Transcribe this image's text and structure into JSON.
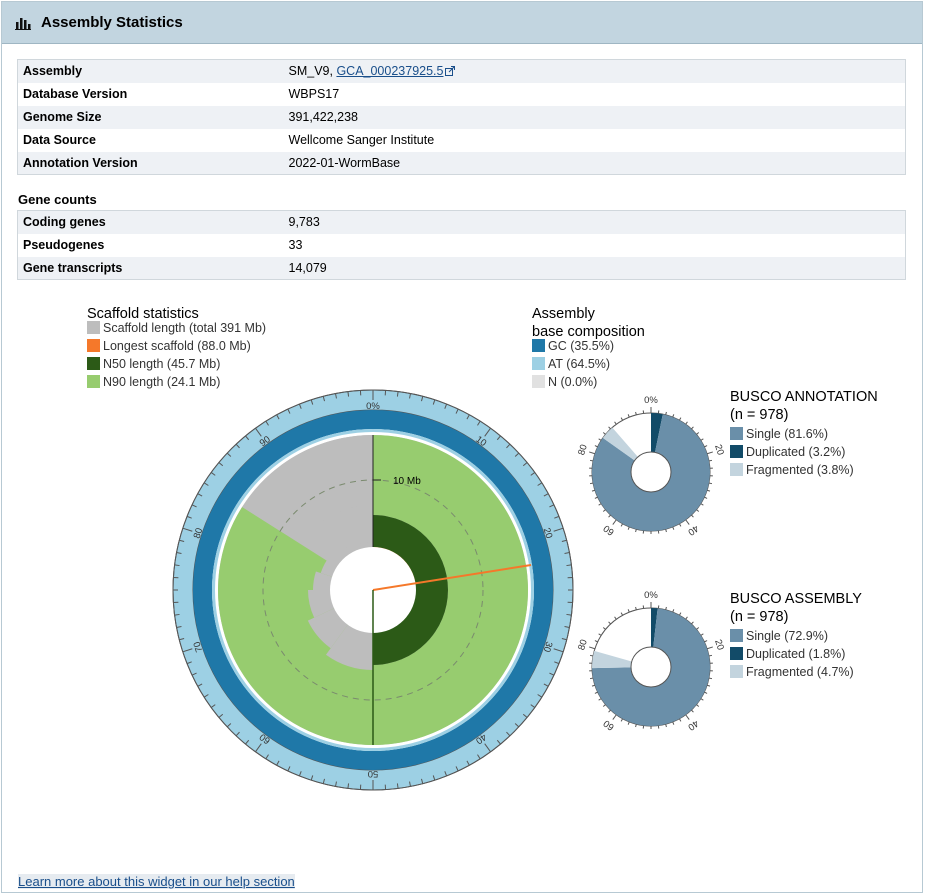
{
  "panel": {
    "title": "Assembly Statistics",
    "icon": "bar-chart-icon"
  },
  "assembly_table": [
    {
      "key": "Assembly",
      "value": "SM_V9, ",
      "link": "GCA_000237925.5"
    },
    {
      "key": "Database Version",
      "value": "WBPS17"
    },
    {
      "key": "Genome Size",
      "value": "391,422,238"
    },
    {
      "key": "Data Source",
      "value": "Wellcome Sanger Institute"
    },
    {
      "key": "Annotation Version",
      "value": "2022-01-WormBase"
    }
  ],
  "gene_counts": {
    "title": "Gene counts",
    "rows": [
      {
        "key": "Coding genes",
        "value": "9,783"
      },
      {
        "key": "Pseudogenes",
        "value": "33"
      },
      {
        "key": "Gene transcripts",
        "value": "14,079"
      }
    ]
  },
  "chart_data": [
    {
      "type": "pie",
      "title": "Scaffold statistics",
      "legend": [
        {
          "label": "Scaffold length (total 391 Mb)",
          "color": "#bdbdbd"
        },
        {
          "label": "Longest scaffold (88.0 Mb)",
          "color": "#f5782a"
        },
        {
          "label": "N50 length (45.7 Mb)",
          "color": "#2c5a17"
        },
        {
          "label": "N90 length (24.1 Mb)",
          "color": "#97cc6f"
        }
      ],
      "total_mb": 391,
      "longest_mb": 88.0,
      "n50_mb": 45.7,
      "n90_mb": 24.1,
      "radial_label": "10 Mb",
      "ticks": [
        "0%",
        "10",
        "20",
        "30",
        "40",
        "50",
        "60",
        "70",
        "80",
        "90"
      ]
    },
    {
      "type": "pie",
      "title": "Assembly",
      "title2": "base composition",
      "legend": [
        {
          "label": "GC (35.5%)",
          "color": "#1f78a8"
        },
        {
          "label": "AT (64.5%)",
          "color": "#9dd0e4"
        },
        {
          "label": "N (0.0%)",
          "color": "#e1e1e1"
        }
      ],
      "values": [
        35.5,
        64.5,
        0.0
      ]
    },
    {
      "type": "pie",
      "title": "BUSCO ANNOTATION",
      "subtitle": "(n = 978)",
      "legend": [
        {
          "label": "Single (81.6%)",
          "color": "#6a8fa9"
        },
        {
          "label": "Duplicated (3.2%)",
          "color": "#124b68"
        },
        {
          "label": "Fragmented (3.8%)",
          "color": "#c3d4de"
        }
      ],
      "values": [
        81.6,
        3.2,
        3.8
      ],
      "ticks": [
        "0%",
        "20",
        "40",
        "60",
        "80"
      ]
    },
    {
      "type": "pie",
      "title": "BUSCO ASSEMBLY",
      "subtitle": "(n = 978)",
      "legend": [
        {
          "label": "Single (72.9%)",
          "color": "#6a8fa9"
        },
        {
          "label": "Duplicated (1.8%)",
          "color": "#124b68"
        },
        {
          "label": "Fragmented (4.7%)",
          "color": "#c3d4de"
        }
      ],
      "values": [
        72.9,
        1.8,
        4.7
      ],
      "ticks": [
        "0%",
        "20",
        "40",
        "60",
        "80"
      ]
    }
  ],
  "help_link": "Learn more about this widget in our help section"
}
